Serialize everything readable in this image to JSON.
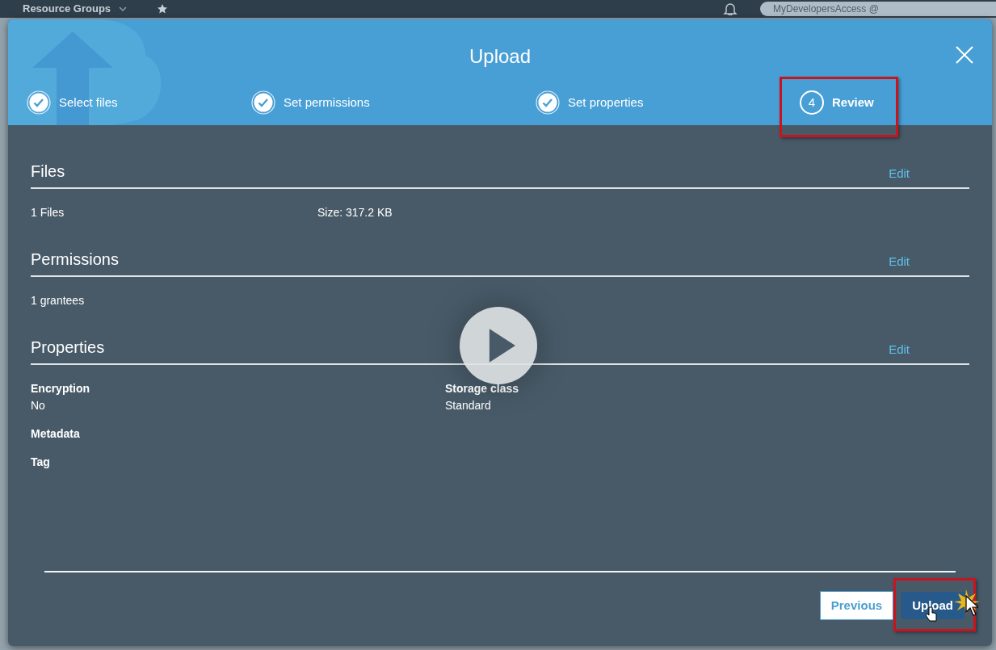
{
  "top_bar": {
    "menu": "Resource Groups",
    "account": "MyDevelopersAccess @"
  },
  "dialog": {
    "title": "Upload",
    "steps": [
      {
        "label": "Select files",
        "completed": true,
        "selected": false,
        "highlighted": false
      },
      {
        "label": "Set permissions",
        "completed": true,
        "selected": false,
        "highlighted": false
      },
      {
        "label": "Set properties",
        "completed": true,
        "selected": false,
        "highlighted": false
      },
      {
        "number": "4",
        "label": "Review",
        "completed": false,
        "selected": true,
        "highlighted": true
      }
    ],
    "sections": [
      {
        "title": "Files",
        "edit": "Edit",
        "kind": "inline",
        "items": [
          {
            "text": "1 Files"
          },
          {
            "text": "Size: 317.2 KB"
          }
        ]
      },
      {
        "title": "Permissions",
        "edit": "Edit",
        "kind": "inline",
        "items": [
          {
            "text": "1 grantees"
          }
        ]
      },
      {
        "title": "Properties",
        "edit": "Edit",
        "kind": "fields",
        "items": [
          {
            "label": "Encryption",
            "value": "No"
          },
          {
            "label": "Storage class",
            "value": "Standard"
          },
          {
            "label": "Metadata"
          },
          {
            "label": "Tag"
          }
        ]
      }
    ],
    "buttons": [
      {
        "label": "Previous",
        "kind": "secondary",
        "highlighted": false
      },
      {
        "label": "Upload",
        "kind": "primary",
        "highlighted": true
      }
    ]
  }
}
